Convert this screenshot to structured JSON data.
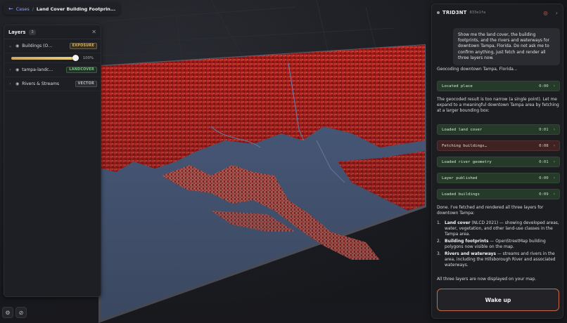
{
  "breadcrumb": {
    "root": "Cases",
    "separator": "/",
    "current": "Land Cover Building Footprin..."
  },
  "layers": {
    "title": "Layers",
    "count": "3",
    "items": [
      {
        "name": "Buildings (OS...",
        "tag": "EXPOSURE",
        "opacity": "100%",
        "opacity_fraction": 1.0
      },
      {
        "name": "tampa-landc...",
        "tag": "LANDCOVER"
      },
      {
        "name": "Rivers & Streams",
        "tag": "VECTOR"
      }
    ]
  },
  "chat": {
    "brand": "TRID3NT",
    "hash": "833e1fa",
    "user_message": "Show me the land cover, the building footprints, and the rivers and waterways for downtown Tampa, Florida. Do not ask me to confirm anything, just fetch and render all three layers now.",
    "geocoding": "Geocoding downtown Tampa, Florida...",
    "tool_located": {
      "label": "Located place",
      "time": "0:00"
    },
    "narrow_note": "The geocoded result is too narrow (a single point). Let me expand to a meaningful downtown Tampa area by fetching at a larger bounding box:",
    "tools": [
      {
        "label": "Loaded land cover",
        "time": "0:01",
        "status": "ok"
      },
      {
        "label": "Fetching buildings…",
        "time": "0:08",
        "status": "pending"
      },
      {
        "label": "Loaded river geometry",
        "time": "0:01",
        "status": "ok"
      },
      {
        "label": "Layer published",
        "time": "0:00",
        "status": "ok"
      },
      {
        "label": "Loaded buildings",
        "time": "0:09",
        "status": "ok"
      }
    ],
    "done_intro": "Done. I've fetched and rendered all three layers for downtown Tampa:",
    "list": [
      {
        "num": "1.",
        "bold": "Land cover",
        "rest": " (NLCD 2021) — showing developed areas, water, vegetation, and other land-use classes in the Tampa area."
      },
      {
        "num": "2.",
        "bold": "Building footprints",
        "rest": " — OpenStreetMap building polygons now visible on the map."
      },
      {
        "num": "3.",
        "bold": "Rivers and waterways",
        "rest": " — streams and rivers in the area, including the Hillsborough River and associated waterways."
      }
    ],
    "done_outro": "All three layers are now displayed on your map.",
    "wake_button": "Wake up"
  },
  "colors": {
    "accent_link": "#8fa3ff",
    "tool_ok": "#253a29",
    "tool_pending": "#3f2222",
    "wake_border": "#c76a4a",
    "exposure_tag": "#e0b45a",
    "landcover_tag": "#7bc48a",
    "map_land": "#b8201c",
    "map_water": "#4c5f82"
  }
}
